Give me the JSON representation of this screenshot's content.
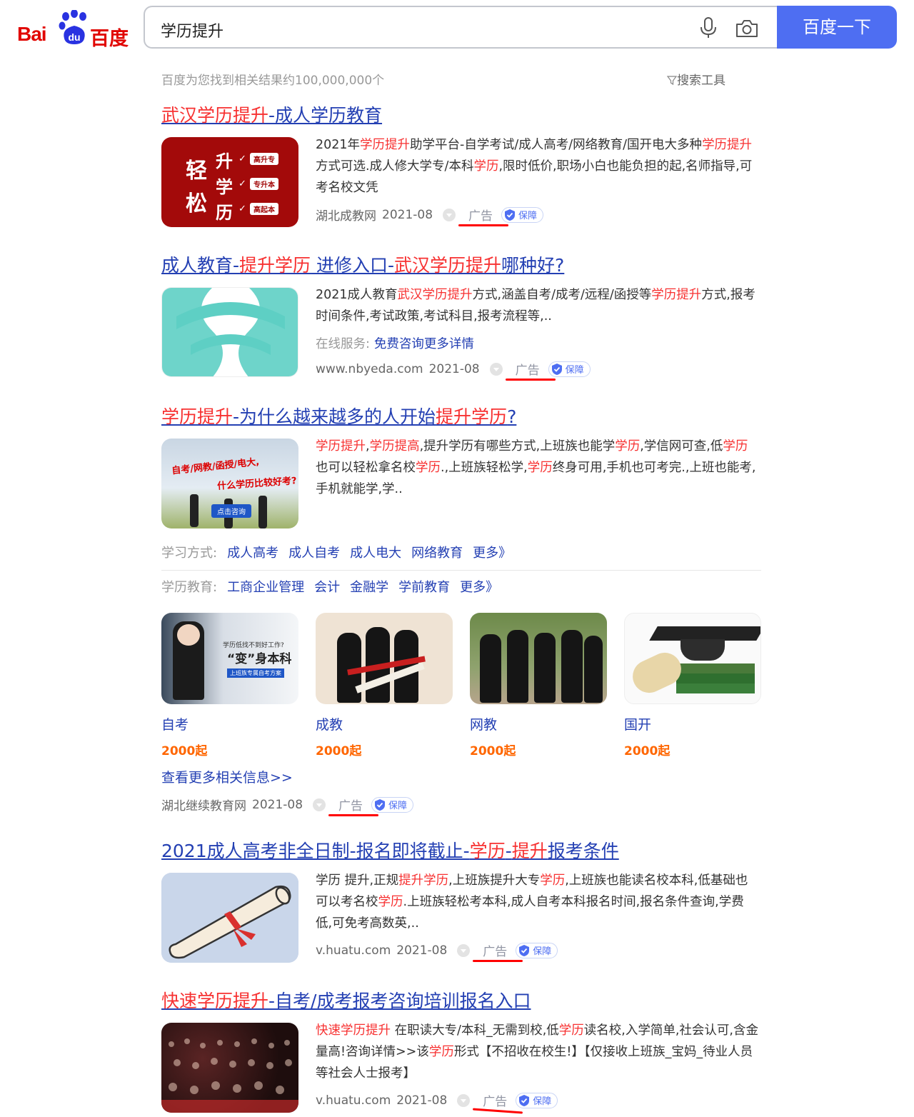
{
  "logo": {
    "latin_a": "Bai",
    "paw_text": "du",
    "chinese": "百度"
  },
  "search": {
    "query": "学历提升",
    "button_label": "百度一下"
  },
  "results_info": {
    "count_text": "百度为您找到相关结果约100,000,000个",
    "tools_label": "搜索工具"
  },
  "ad_label": "广告",
  "guard_label": "保障",
  "results": [
    {
      "title": [
        [
          "武汉学历提升",
          true
        ],
        [
          "-成人学历教育",
          false
        ]
      ],
      "thumb_text": {
        "big1": "轻",
        "big2": "松",
        "r1": "升",
        "r2": "学",
        "r3": "历",
        "tag1": "高升专",
        "tag2": "专升本",
        "tag3": "高起本"
      },
      "snippet": [
        [
          "2021年",
          false
        ],
        [
          "学历提升",
          true
        ],
        [
          "助学平台-自学考试/成人高考/网络教育/国开电大多种",
          false
        ],
        [
          "学历提升",
          true
        ],
        [
          "方式可选.成人修大学专/本科",
          false
        ],
        [
          "学历",
          true
        ],
        [
          ",限时低价,职场小白也能负担的起,名师指导,可考名校文凭",
          false
        ]
      ],
      "site": "湖北成教网",
      "date": "2021-08"
    },
    {
      "title": [
        [
          "成人教育-",
          false
        ],
        [
          "提升学历",
          true
        ],
        [
          " 进修入口-",
          false
        ],
        [
          "武汉学历提升",
          true
        ],
        [
          "哪种好?",
          false
        ]
      ],
      "snippet": [
        [
          "2021成人教育",
          false
        ],
        [
          "武汉学历提升",
          true
        ],
        [
          "方式,涵盖自考/成考/远程/函授等",
          false
        ],
        [
          "学历提升",
          true
        ],
        [
          "方式,报考时间条件,考试政策,考试科目,报考流程等,..",
          false
        ]
      ],
      "online_label": "在线服务:",
      "online_link": "免费咨询更多详情",
      "site": "www.nbyeda.com",
      "date": "2021-08"
    },
    {
      "title": [
        [
          "学历提升",
          true
        ],
        [
          "-为什么越来越多的人开始",
          false
        ],
        [
          "提升学历",
          true
        ],
        [
          "?",
          false
        ]
      ],
      "thumb_text": {
        "line1": "自考/网教/函授/电大,",
        "line2": "什么学历比较好考?",
        "button": "点击咨询"
      },
      "snippet": [
        [
          "学历提升",
          true
        ],
        [
          ",",
          false
        ],
        [
          "学历提高",
          true
        ],
        [
          ",提升学历有哪些方式,上班族也能学",
          false
        ],
        [
          "学历",
          true
        ],
        [
          ",学信网可查,低",
          false
        ],
        [
          "学历",
          true
        ],
        [
          "也可以轻松拿名校",
          false
        ],
        [
          "学历",
          true
        ],
        [
          ".,上班族轻松学,",
          false
        ],
        [
          "学历",
          true
        ],
        [
          "终身可用,手机也可考完.,上班也能考,手机就能学,学..",
          false
        ]
      ],
      "sub_rows": [
        {
          "label": "学习方式:",
          "links": [
            "成人高考",
            "成人自考",
            "成人电大",
            "网络教育",
            "更多》"
          ]
        },
        {
          "label": "学历教育:",
          "links": [
            "工商企业管理",
            "会计",
            "金融学",
            "学前教育",
            "更多》"
          ]
        }
      ],
      "cards": [
        {
          "name": "自考",
          "price": "2000起",
          "img_text1": "学历低找不到好工作?",
          "img_text2": "“变”身本科",
          "img_text3": "上班族专属自考方案"
        },
        {
          "name": "成教",
          "price": "2000起"
        },
        {
          "name": "网教",
          "price": "2000起"
        },
        {
          "name": "国开",
          "price": "2000起"
        }
      ],
      "more_info": "查看更多相关信息>>",
      "site": "湖北继续教育网",
      "date": "2021-08"
    },
    {
      "title": [
        [
          "2021成人高考非全日制-报名即将截止-",
          false
        ],
        [
          "学历",
          true
        ],
        [
          "-",
          false
        ],
        [
          "提升",
          true
        ],
        [
          "报考条件",
          false
        ]
      ],
      "snippet": [
        [
          "学历 提升,正规",
          false
        ],
        [
          "提升学历",
          true
        ],
        [
          ",上班族提升大专",
          false
        ],
        [
          "学历",
          true
        ],
        [
          ",上班族也能读名校本科,低基础也可以考名校",
          false
        ],
        [
          "学历",
          true
        ],
        [
          ".上班族轻松考本科,成人自考本科报名时间,报名条件查询,学费低,可免考高数英,..",
          false
        ]
      ],
      "site": "v.huatu.com",
      "date": "2021-08"
    },
    {
      "title": [
        [
          "快速学历提升",
          true
        ],
        [
          "-自考/成考报考咨询培训报名入口",
          false
        ]
      ],
      "snippet": [
        [
          "快速学历提升",
          true
        ],
        [
          " 在职读大专/本科_无需到校,低",
          false
        ],
        [
          "学历",
          true
        ],
        [
          "读名校,入学简单,社会认可,含金量高!咨询详情>>该",
          false
        ],
        [
          "学历",
          true
        ],
        [
          "形式【不招收在校生!】【仅接收上班族_宝妈_待业人员等社会人士报考】",
          false
        ]
      ],
      "site": "v.huatu.com",
      "date": "2021-08"
    }
  ],
  "colors": {
    "link": "#2440b3",
    "highlight": "#f73131",
    "button": "#4e6ef2",
    "price": "#ff6600",
    "ad_underline": "#ff0000"
  },
  "icons": [
    "baidu-paw-icon",
    "microphone-icon",
    "camera-icon",
    "filter-icon",
    "shield-check-icon",
    "dropdown-dot-icon"
  ]
}
